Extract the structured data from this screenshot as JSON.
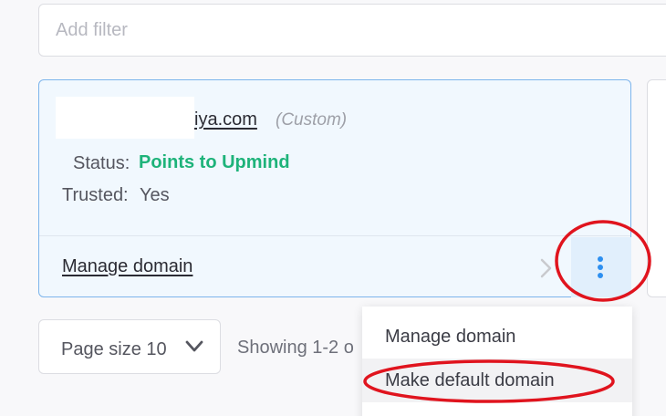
{
  "filter": {
    "placeholder": "Add filter"
  },
  "domain_card": {
    "name": "iya.com",
    "type": "(Custom)",
    "status_label": "Status:",
    "status_value": "Points to Upmind",
    "trusted_label": "Trusted:",
    "trusted_value": "Yes",
    "manage_link": "Manage domain",
    "status_color": "#1eb37a",
    "accent_color": "#2d8ff0"
  },
  "pagination": {
    "page_size_label": "Page size 10",
    "showing": "Showing 1-2 o"
  },
  "menu": {
    "items": [
      {
        "label": "Manage domain"
      },
      {
        "label": "Make default domain"
      }
    ]
  },
  "icons": {
    "chevron_right": "chevron-right-icon",
    "kebab": "vertical-dots-icon",
    "chevron_down": "chevron-down-icon"
  },
  "annotations": {
    "color": "#e0141e"
  }
}
